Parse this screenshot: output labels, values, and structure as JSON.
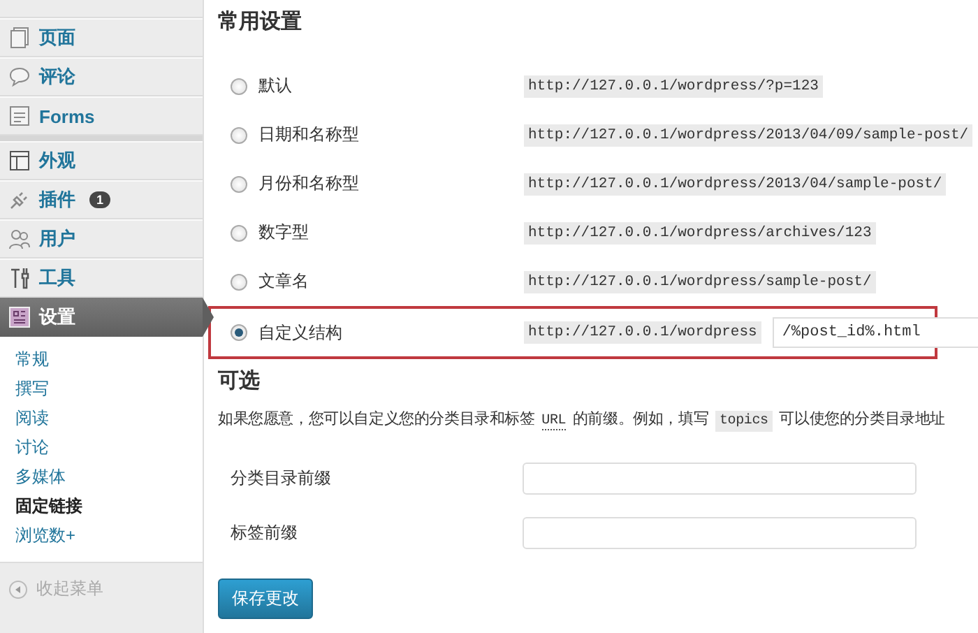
{
  "sidebar": {
    "menu": [
      {
        "label": "页面",
        "selected": false
      },
      {
        "label": "评论",
        "selected": false
      },
      {
        "label": "Forms",
        "selected": false
      },
      {
        "label": "外观",
        "selected": false
      },
      {
        "label": "插件",
        "selected": false,
        "badge": "1"
      },
      {
        "label": "用户",
        "selected": false
      },
      {
        "label": "工具",
        "selected": false
      },
      {
        "label": "设置",
        "selected": true
      }
    ],
    "submenu": [
      {
        "label": "常规",
        "selected": false
      },
      {
        "label": "撰写",
        "selected": false
      },
      {
        "label": "阅读",
        "selected": false
      },
      {
        "label": "讨论",
        "selected": false
      },
      {
        "label": "多媒体",
        "selected": false
      },
      {
        "label": "固定链接",
        "selected": true
      },
      {
        "label": "浏览数+",
        "selected": false
      }
    ],
    "collapse": "收起菜单"
  },
  "common": {
    "title": "常用设置",
    "options": [
      {
        "label": "默认",
        "selected": false,
        "highlighted": false,
        "url": "http://127.0.0.1/wordpress/?p=123"
      },
      {
        "label": "日期和名称型",
        "selected": false,
        "highlighted": false,
        "url": "http://127.0.0.1/wordpress/2013/04/09/sample-post/"
      },
      {
        "label": "月份和名称型",
        "selected": false,
        "highlighted": false,
        "url": "http://127.0.0.1/wordpress/2013/04/sample-post/"
      },
      {
        "label": "数字型",
        "selected": false,
        "highlighted": false,
        "url": "http://127.0.0.1/wordpress/archives/123"
      },
      {
        "label": "文章名",
        "selected": false,
        "highlighted": false,
        "url": "http://127.0.0.1/wordpress/sample-post/"
      },
      {
        "label": "自定义结构",
        "selected": true,
        "highlighted": true,
        "url": "http://127.0.0.1/wordpress",
        "value": "/%post_id%.html"
      }
    ]
  },
  "optional": {
    "title": "可选",
    "description": [
      {
        "kind": "text",
        "text": "如果您愿意，您可以自定义您的分类目录和标签 "
      },
      {
        "kind": "abbr",
        "text": "URL"
      },
      {
        "kind": "text",
        "text": " 的前缀。例如，填写 "
      },
      {
        "kind": "code",
        "text": "topics"
      },
      {
        "kind": "text",
        "text": " 可以使您的分类目录地址"
      }
    ],
    "fields": [
      {
        "label": "分类目录前缀"
      },
      {
        "label": "标签前缀"
      }
    ]
  },
  "save_button": "保存更改"
}
